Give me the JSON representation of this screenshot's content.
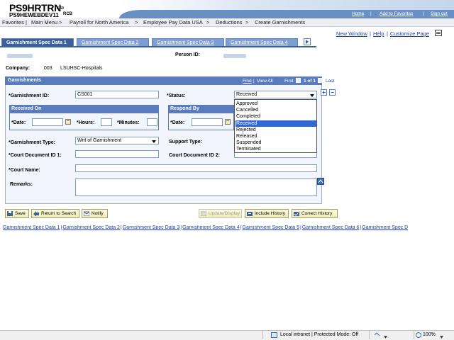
{
  "header": {
    "app_name": "PS9HRTRN",
    "version": "8.50",
    "db_name": "PS9HEWEBDEV11",
    "db_suffix": "RCB",
    "links": [
      "Home",
      "Add to Favorites",
      "Sign out"
    ]
  },
  "breadcrumb": [
    "Favorites",
    "Main Menu",
    "Payroll for North America",
    "Employee Pay Data USA",
    "Deductions",
    "Create Garnishments"
  ],
  "page_links": {
    "new_window": "New Window",
    "help": "Help",
    "customize": "Customize Page",
    "sep": "|"
  },
  "tabs": [
    {
      "label": "Garnishment Spec Data 1",
      "active": true
    },
    {
      "label": "Garnishment Spec Data 2",
      "active": false
    },
    {
      "label": "Garnishment Spec Data 3",
      "active": false
    },
    {
      "label": "Garnishment Spec Data 4",
      "active": false
    }
  ],
  "person": {
    "person_id_label": "Person ID:",
    "company_label": "Company:",
    "company_code": "003",
    "company_name": "LSUHSC-Hospitals"
  },
  "group": {
    "title": "Garnishments",
    "find": "Find",
    "view_all": "View All",
    "sep": "|",
    "first": "First",
    "range": "1 of 1",
    "last": "Last"
  },
  "form": {
    "garnishment_id_label": "*Garnishment ID:",
    "garnishment_id_value": "CS001",
    "status_label": "*Status:",
    "status_value": "Received",
    "received_on": {
      "title": "Received On",
      "date_label": "*Date:",
      "hours_label": "*Hours:",
      "minutes_label": "*Minutes:"
    },
    "respond_by": {
      "title": "Respond By",
      "date_label": "*Date:"
    },
    "garnishment_type_label": "*Garnishment Type:",
    "garnishment_type_value": "Writ of Garnishment",
    "support_type_label": "Support Type:",
    "court_doc_id1_label": "*Court Document ID 1:",
    "court_doc_id2_label": "Court Document ID 2:",
    "court_name_label": "*Court Name:",
    "remarks_label": "Remarks:"
  },
  "status_options": [
    "Approved",
    "Cancelled",
    "Completed",
    "Received",
    "Rejected",
    "Released",
    "Suspended",
    "Terminated"
  ],
  "status_selected_index": 3,
  "buttons": {
    "save": "Save",
    "return_to_search": "Return to Search",
    "notify": "Notify",
    "update_display": "Update/Display",
    "include_history": "Include History",
    "correct_history": "Correct History"
  },
  "bottom_links": [
    "Garnishment Spec Data 1",
    "Garnishment Spec Data 2",
    "Garnishment Spec Data 3",
    "Garnishment Spec Data 4",
    "Garnishment Spec Data 5",
    "Garnishment Spec Data 6",
    "Garnishment Spec D"
  ],
  "bottom_sep": "|",
  "statusbar": {
    "zone": "Local intranet | Protected Mode: Off",
    "zoom": "100%"
  },
  "colors": {
    "tab_active": "#3d5f9c",
    "tab_inactive": "#7c9ed0",
    "group_header": "#5a7cbd",
    "dropdown_selected": "#3168d5",
    "link": "#1b3ea8"
  }
}
